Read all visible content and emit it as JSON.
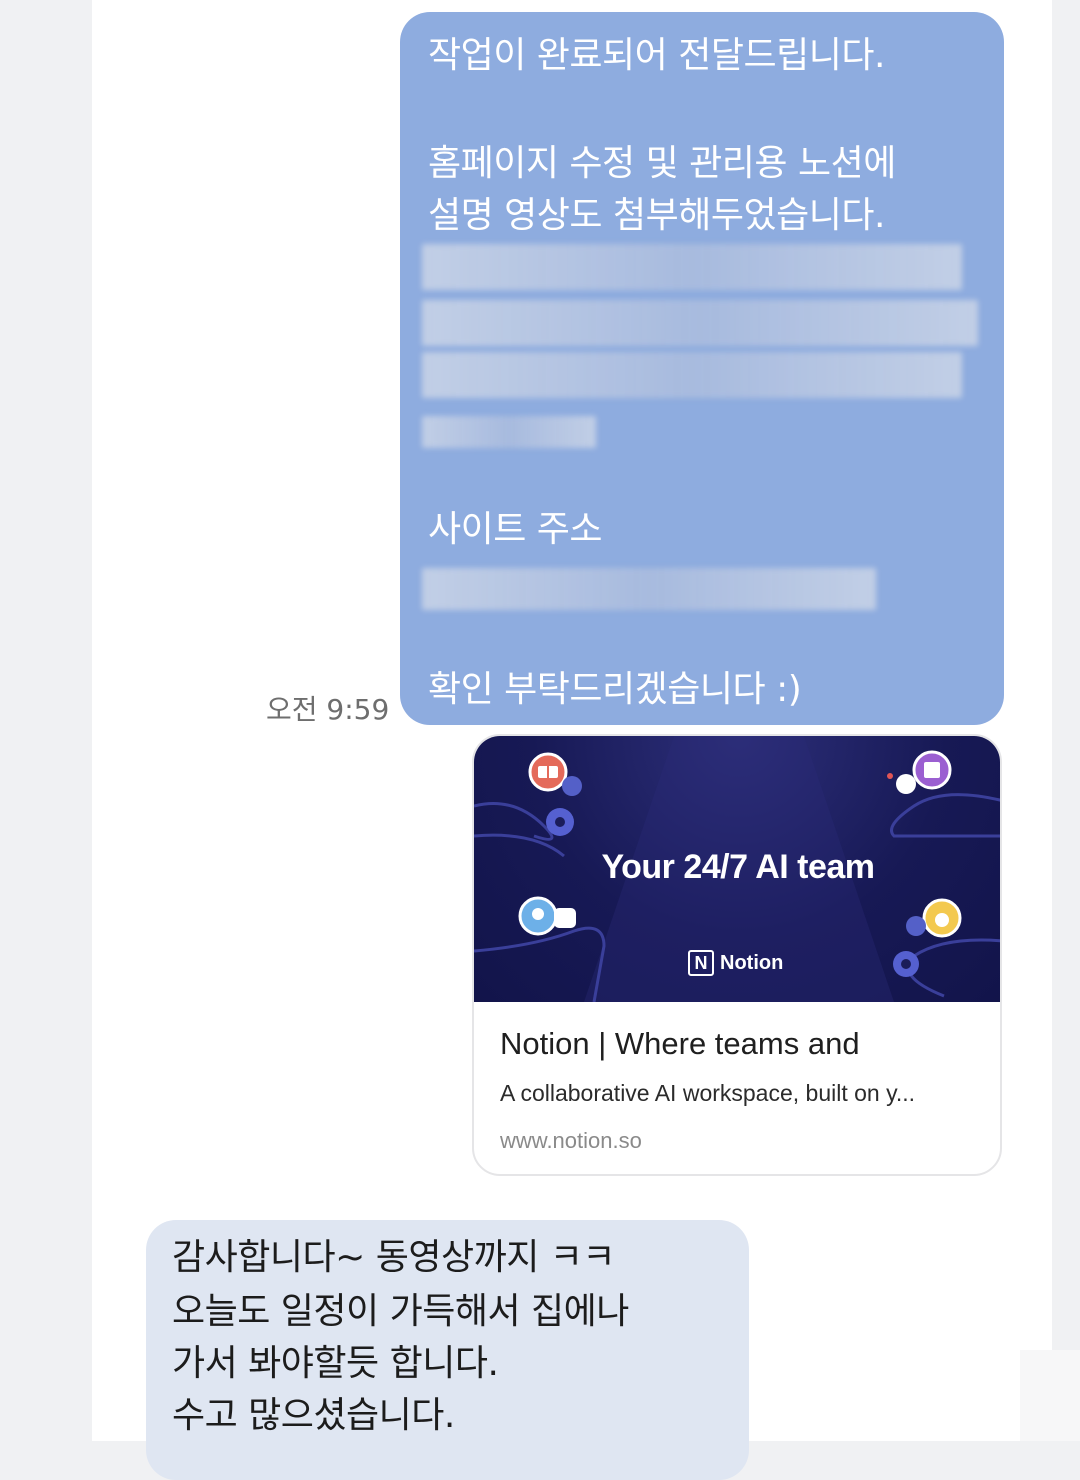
{
  "sent_message": {
    "lines": [
      "작업이 완료되어 전달드립니다.",
      "홈페이지 수정 및 관리용 노션에",
      "설명 영상도 첨부해두었습니다.",
      "사이트 주소",
      "확인 부탁드리겠습니다 :)"
    ],
    "bubble_color": "#8eacdf"
  },
  "timestamp": "오전 9:59",
  "link_preview": {
    "image_headline": "Your 24/7 AI team",
    "image_brand": "Notion",
    "title": "Notion | Where teams and",
    "description": "A collaborative AI workspace, built on y...",
    "url": "www.notion.so"
  },
  "received_message": {
    "lines": [
      "감사합니다~ 동영상까지 ㅋㅋ",
      "오늘도 일정이 가득해서 집에나",
      "가서 봐야할듯 합니다.",
      "수고 많으셨습니다."
    ],
    "bubble_color": "#dfe6f2"
  }
}
